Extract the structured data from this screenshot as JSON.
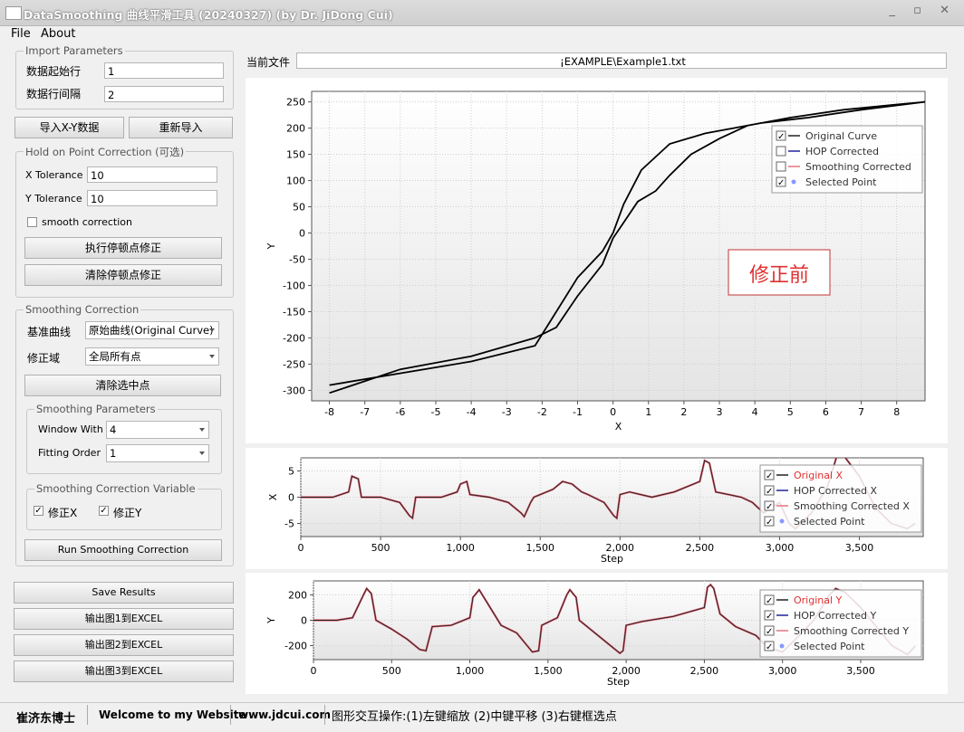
{
  "window": {
    "title": "DataSmoothing 曲线平滑工具 (20240327) (by Dr. JiDong Cui)",
    "controls": "_ ▫ ✕"
  },
  "menu": {
    "file": "File",
    "about": "About"
  },
  "import": {
    "legend": "Import Parameters",
    "start_row_label": "数据起始行",
    "start_row_value": "1",
    "row_interval_label": "数据行间隔",
    "row_interval_value": "2",
    "import_button": "导入X-Y数据",
    "reimport_button": "重新导入"
  },
  "hop": {
    "legend": "Hold on Point Correction (可选)",
    "x_tol_label": "X Tolerance",
    "x_tol_value": "10",
    "y_tol_label": "Y Tolerance",
    "y_tol_value": "10",
    "smooth_label": "smooth correction",
    "smooth_checked": false,
    "run_button": "执行停顿点修正",
    "clear_button": "清除停顿点修正"
  },
  "smoothing": {
    "legend": "Smoothing Correction",
    "base_label": "基准曲线",
    "base_value": "原始曲线(Original Curve)",
    "domain_label": "修正域",
    "domain_value": "全局所有点",
    "clear_selected_button": "清除选中点",
    "params_legend": "Smoothing Parameters",
    "window_label": "Window With",
    "window_value": "4",
    "order_label": "Fitting Order",
    "order_value": "1",
    "variable_legend": "Smoothing Correction Variable",
    "fix_x_label": "修正X",
    "fix_y_label": "修正Y",
    "run_button": "Run Smoothing Correction"
  },
  "results": {
    "save_button": "Save Results",
    "export1": "输出图1到EXCEL",
    "export2": "输出图2到EXCEL",
    "export3": "输出图3到EXCEL"
  },
  "file": {
    "label": "当前文件",
    "path": "¡EXAMPLE\\Example1.txt"
  },
  "status": {
    "author": "崔济东博士",
    "welcome": "Welcome to my Website",
    "site": "www.jdcui.com",
    "hint": "图形交互操作:(1)左键缩放 (2)中键平移 (3)右键框选点"
  },
  "colors": {
    "original": "#000000",
    "hop": "#00008b",
    "smoothing": "#e06070",
    "selected": "#8899ff",
    "annotation": "#e03030"
  },
  "chart_data": [
    {
      "type": "line",
      "title": "",
      "annotation": "修正前",
      "xlabel": "X",
      "ylabel": "Y",
      "xlim": [
        -8.5,
        8.8
      ],
      "ylim": [
        -320,
        270
      ],
      "xticks": [
        "-8",
        "-7",
        "-6",
        "-5",
        "-4",
        "-3",
        "-2",
        "-1",
        "0",
        "1",
        "2",
        "3",
        "4",
        "5",
        "6",
        "7",
        "8"
      ],
      "yticks": [
        "250",
        "200",
        "150",
        "100",
        "50",
        "0",
        "-50",
        "-100",
        "-150",
        "-200",
        "-250",
        "-300"
      ],
      "legend": [
        {
          "name": "Original Curve",
          "checked": true
        },
        {
          "name": "HOP Corrected",
          "checked": false
        },
        {
          "name": "Smoothing Corrected",
          "checked": false
        },
        {
          "name": "Selected Point",
          "checked": true
        }
      ],
      "series": [
        {
          "name": "Original Curve",
          "x": [
            -8,
            -4,
            -2.2,
            -1.6,
            -1,
            -0.3,
            0,
            0.3,
            0.8,
            1.6,
            2.6,
            3.4,
            4.2,
            5.5,
            7,
            8.8,
            8,
            6.5,
            5,
            3.8,
            3,
            2.2,
            1.6,
            1.2,
            0.7,
            0.3,
            0,
            -0.3,
            -1,
            -1.6,
            -2.2,
            -4,
            -6,
            -8
          ],
          "y": [
            -290,
            -245,
            -215,
            -150,
            -85,
            -35,
            0,
            55,
            120,
            170,
            190,
            200,
            210,
            220,
            235,
            250,
            245,
            235,
            220,
            205,
            180,
            150,
            110,
            80,
            60,
            20,
            -10,
            -60,
            -120,
            -180,
            -200,
            -235,
            -260,
            -305
          ]
        }
      ]
    },
    {
      "type": "line",
      "xlabel": "Step",
      "ylabel": "X",
      "xlim": [
        0,
        3900
      ],
      "ylim": [
        -7.5,
        7.5
      ],
      "xticks": [
        "0",
        "500",
        "1,000",
        "1,500",
        "2,000",
        "2,500",
        "3,000",
        "3,500"
      ],
      "yticks": [
        "5",
        "0",
        "-5"
      ],
      "legend": [
        {
          "name": "Original X",
          "checked": true
        },
        {
          "name": "HOP Corrected X",
          "checked": true
        },
        {
          "name": "Smoothing Corrected X",
          "checked": true
        },
        {
          "name": "Selected Point",
          "checked": true
        }
      ],
      "series": [
        {
          "name": "Original X",
          "x": [
            0,
            140,
            200,
            300,
            320,
            360,
            380,
            500,
            620,
            680,
            700,
            720,
            760,
            880,
            980,
            1000,
            1040,
            1060,
            1180,
            1300,
            1380,
            1400,
            1440,
            1460,
            1580,
            1640,
            1700,
            1760,
            1800,
            1900,
            1960,
            1980,
            2000,
            2060,
            2200,
            2340,
            2500,
            2530,
            2560,
            2600,
            2680,
            2760,
            2830,
            2900,
            3000,
            3060,
            3100,
            3200,
            3300,
            3360,
            3400,
            3500,
            3600,
            3700,
            3800,
            3850
          ],
          "y": [
            0,
            0,
            0,
            1,
            4,
            3.5,
            0,
            0,
            -1,
            -3.5,
            -4,
            0,
            0,
            0,
            1,
            2.5,
            3,
            0.5,
            0,
            -1,
            -3,
            -3.7,
            -1,
            0,
            1.5,
            3,
            2.5,
            1,
            0.5,
            -1,
            -3.5,
            -4,
            0.5,
            1,
            0,
            1,
            3,
            7,
            6.5,
            1,
            0.5,
            0,
            -1,
            -3,
            -1,
            -5,
            -6,
            -3,
            2,
            8,
            8,
            4,
            -2,
            -5,
            -6,
            -5
          ]
        }
      ]
    },
    {
      "type": "line",
      "xlabel": "Step",
      "ylabel": "Y",
      "xlim": [
        0,
        3900
      ],
      "ylim": [
        -310,
        310
      ],
      "xticks": [
        "0",
        "500",
        "1,000",
        "1,500",
        "2,000",
        "2,500",
        "3,000",
        "3,500"
      ],
      "yticks": [
        "200",
        "0",
        "-200"
      ],
      "legend": [
        {
          "name": "Original Y",
          "checked": true
        },
        {
          "name": "HOP Corrected Y",
          "checked": true
        },
        {
          "name": "Smoothing Corrected Y",
          "checked": true
        },
        {
          "name": "Selected Point",
          "checked": true
        }
      ],
      "series": [
        {
          "name": "Original Y",
          "x": [
            0,
            150,
            250,
            320,
            340,
            370,
            400,
            500,
            600,
            680,
            720,
            760,
            880,
            1000,
            1020,
            1060,
            1100,
            1200,
            1300,
            1400,
            1440,
            1460,
            1560,
            1620,
            1640,
            1680,
            1700,
            1800,
            1900,
            1960,
            1980,
            2000,
            2100,
            2300,
            2500,
            2520,
            2540,
            2560,
            2600,
            2700,
            2830,
            2900,
            3000,
            3100,
            3200,
            3300,
            3340,
            3400,
            3500,
            3600,
            3700,
            3800,
            3850
          ],
          "y": [
            0,
            0,
            20,
            200,
            250,
            210,
            0,
            -70,
            -150,
            -230,
            -240,
            -50,
            -40,
            20,
            180,
            240,
            160,
            -40,
            -100,
            -250,
            -240,
            -40,
            20,
            200,
            240,
            180,
            0,
            -100,
            -200,
            -260,
            -240,
            -40,
            -10,
            30,
            100,
            260,
            280,
            250,
            50,
            -50,
            -120,
            -210,
            -250,
            -130,
            0,
            200,
            250,
            220,
            100,
            -50,
            -200,
            -270,
            -200
          ]
        }
      ]
    }
  ]
}
